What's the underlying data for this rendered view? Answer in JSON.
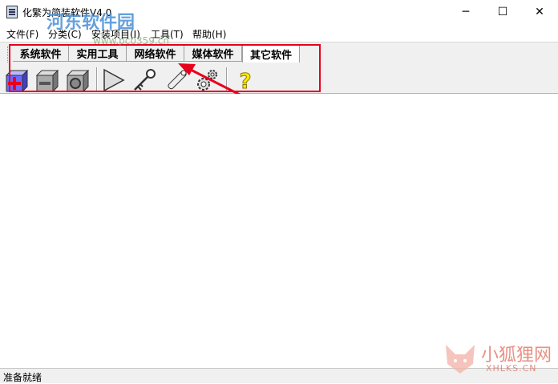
{
  "window": {
    "title": "化繁为简装软件V4.0",
    "controls": {
      "minimize": "─",
      "maximize": "☐",
      "close": "✕"
    }
  },
  "menu": {
    "items": [
      "文件(F)",
      "分类(C)",
      "安装项目(I)",
      "工具(T)",
      "帮助(H)"
    ]
  },
  "tabs": {
    "items": [
      "系统软件",
      "实用工具",
      "网络软件",
      "媒体软件",
      "其它软件"
    ],
    "active": "其它软件"
  },
  "toolbar": {
    "icons": [
      "add-icon",
      "remove-icon",
      "properties-icon",
      "run-icon",
      "key-icon",
      "wrench-icon",
      "settings-icon",
      "help-icon"
    ]
  },
  "status": {
    "text": "准备就绪"
  },
  "watermarks": {
    "top_left": "河东软件园",
    "top_left_url": "www.pc0359.cn",
    "bottom_right": "小狐狸网",
    "bottom_right_url": "XHLKS.CN"
  },
  "colors": {
    "annotation_red": "#e8001c",
    "tab_bg": "#f0f0f0"
  }
}
